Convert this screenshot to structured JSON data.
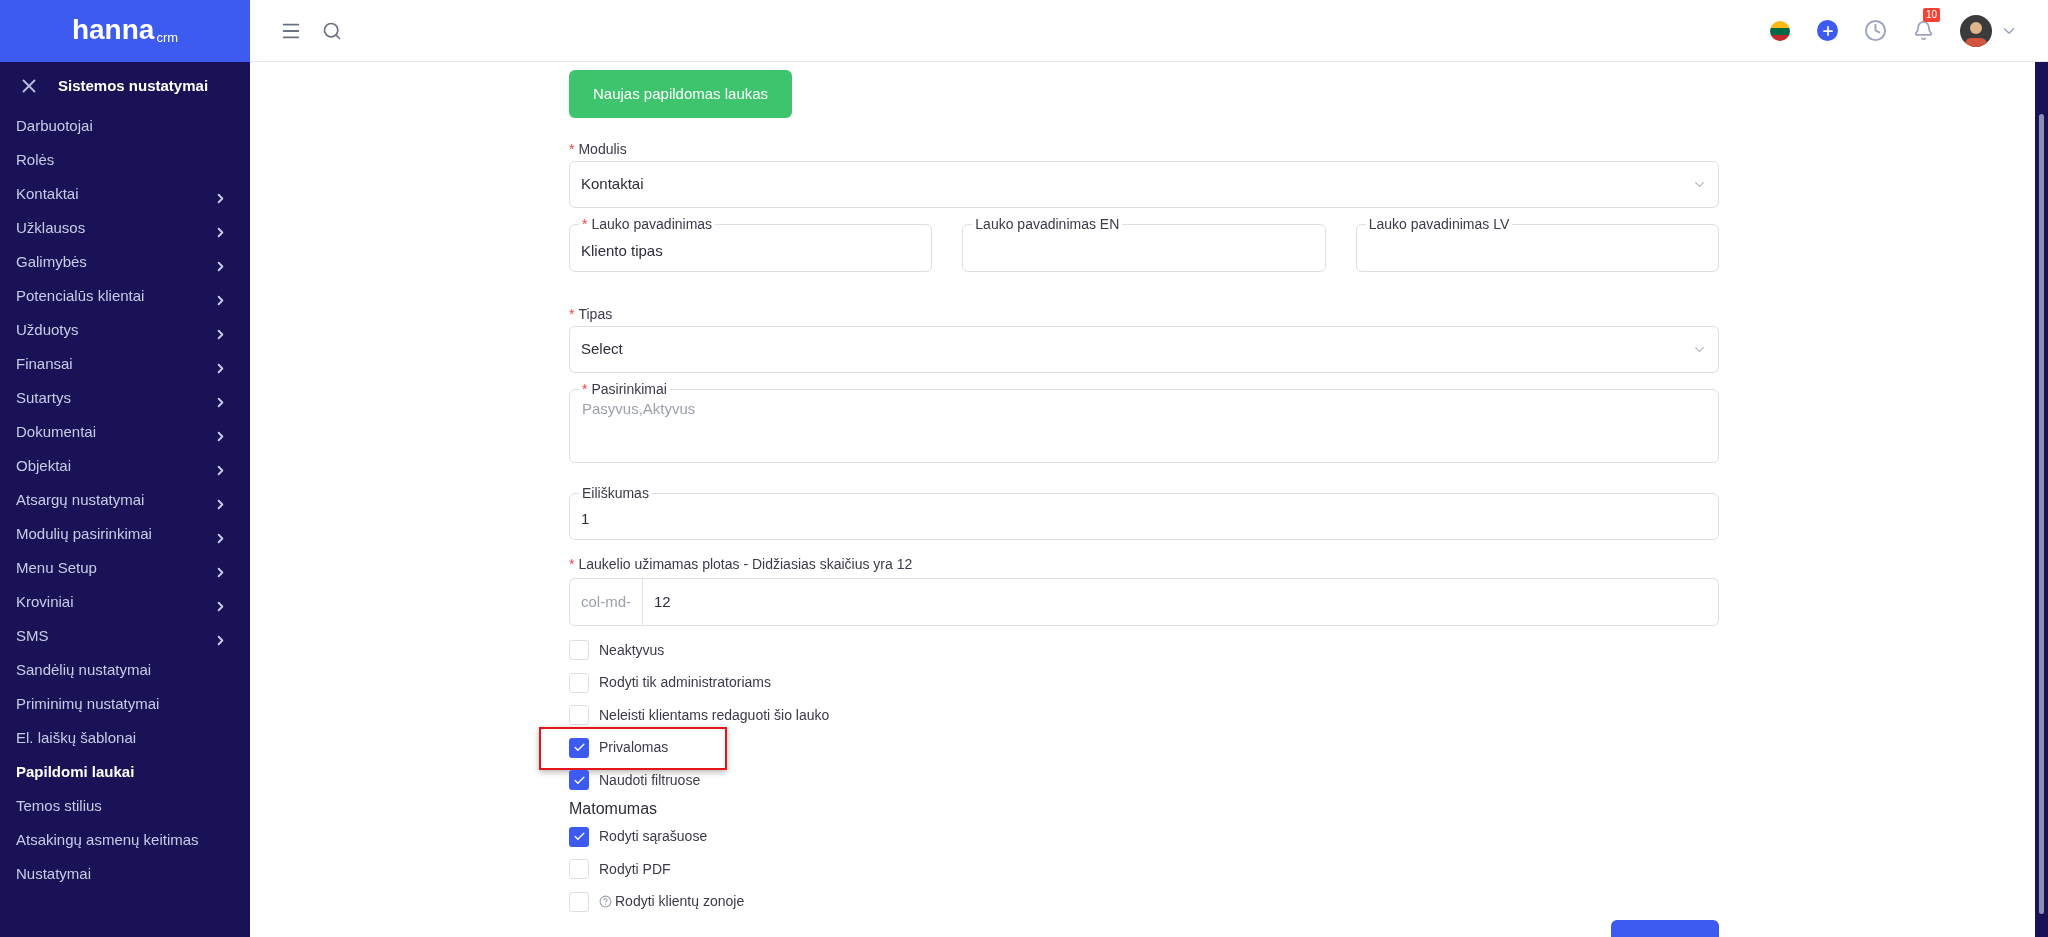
{
  "logo": {
    "main": "hanna",
    "sub": "crm"
  },
  "sidebar": {
    "title": "Sistemos nustatymai",
    "items": [
      {
        "label": "Darbuotojai",
        "has_children": false,
        "selected": false
      },
      {
        "label": "Rolės",
        "has_children": false,
        "selected": false
      },
      {
        "label": "Kontaktai",
        "has_children": true,
        "selected": false
      },
      {
        "label": "Užklausos",
        "has_children": true,
        "selected": false
      },
      {
        "label": "Galimybės",
        "has_children": true,
        "selected": false
      },
      {
        "label": "Potencialūs klientai",
        "has_children": true,
        "selected": false
      },
      {
        "label": "Užduotys",
        "has_children": true,
        "selected": false
      },
      {
        "label": "Finansai",
        "has_children": true,
        "selected": false
      },
      {
        "label": "Sutartys",
        "has_children": true,
        "selected": false
      },
      {
        "label": "Dokumentai",
        "has_children": true,
        "selected": false
      },
      {
        "label": "Objektai",
        "has_children": true,
        "selected": false
      },
      {
        "label": "Atsargų nustatymai",
        "has_children": true,
        "selected": false
      },
      {
        "label": "Modulių pasirinkimai",
        "has_children": true,
        "selected": false
      },
      {
        "label": "Menu Setup",
        "has_children": true,
        "selected": false
      },
      {
        "label": "Kroviniai",
        "has_children": true,
        "selected": false
      },
      {
        "label": "SMS",
        "has_children": true,
        "selected": false
      },
      {
        "label": "Sandėlių nustatymai",
        "has_children": false,
        "selected": false
      },
      {
        "label": "Priminimų nustatymai",
        "has_children": false,
        "selected": false
      },
      {
        "label": "El. laiškų šablonai",
        "has_children": false,
        "selected": false
      },
      {
        "label": "Papildomi laukai",
        "has_children": false,
        "selected": true
      },
      {
        "label": "Temos stilius",
        "has_children": false,
        "selected": false
      },
      {
        "label": "Atsakingų asmenų keitimas",
        "has_children": false,
        "selected": false
      },
      {
        "label": "Nustatymai",
        "has_children": false,
        "selected": false
      }
    ]
  },
  "header": {
    "notification_count": "10"
  },
  "form": {
    "new_button": "Naujas papildomas laukas",
    "module": {
      "label": "Modulis",
      "required_mark": "*",
      "value": "Kontaktai"
    },
    "names": [
      {
        "label": "Lauko pavadinimas",
        "required_mark": "*",
        "value": "Kliento tipas"
      },
      {
        "label": "Lauko pavadinimas EN"
      },
      {
        "label": "Lauko pavadinimas LV"
      }
    ],
    "type": {
      "label": "Tipas",
      "required_mark": "*",
      "value": "Select"
    },
    "options": {
      "label": "Pasirinkimai",
      "required_mark": "*",
      "placeholder": "Pasyvus,Aktyvus"
    },
    "order": {
      "label": "Eiliškumas",
      "value": "1"
    },
    "width": {
      "label": "Laukelio užimamas plotas - Didžiasias skaičius yra 12",
      "required_mark": "*",
      "prefix": "col-md-",
      "value": "12"
    },
    "flags": [
      {
        "label": "Neaktyvus",
        "checked": false,
        "highlighted": false
      },
      {
        "label": "Rodyti tik administratoriams",
        "checked": false,
        "highlighted": false
      },
      {
        "label": "Neleisti klientams redaguoti šio lauko",
        "checked": false,
        "highlighted": false
      },
      {
        "label": "Privalomas",
        "checked": true,
        "highlighted": true
      },
      {
        "label": "Naudoti filtruose",
        "checked": true,
        "highlighted": false
      }
    ],
    "visibility_title": "Matomumas",
    "visibility": [
      {
        "label": "Rodyti sąrašuose",
        "checked": true,
        "help": false
      },
      {
        "label": "Rodyti PDF",
        "checked": false,
        "help": false
      },
      {
        "label": "Rodyti klientų zonoje",
        "checked": false,
        "help": true
      }
    ]
  }
}
